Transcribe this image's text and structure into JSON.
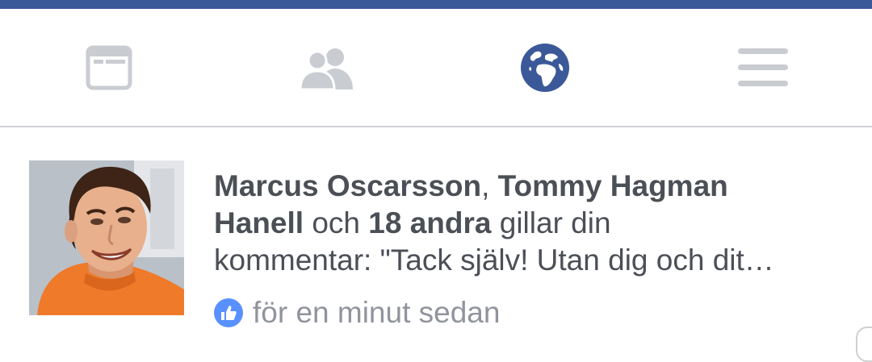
{
  "tabs": [
    {
      "icon": "news-feed-icon",
      "active": false
    },
    {
      "icon": "friends-icon",
      "active": false
    },
    {
      "icon": "globe-notifications-icon",
      "active": true
    },
    {
      "icon": "menu-icon",
      "active": false
    }
  ],
  "colors": {
    "brand": "#3b5998",
    "inactive_icon": "#c9ccd1",
    "text": "#4b4f56",
    "time": "#90949c",
    "like_badge": "#5890ff"
  },
  "notification": {
    "user1": "Marcus Oscarsson",
    "sep1": ", ",
    "user2_part1": "Tommy Hagman",
    "user2_part2": "Hanell",
    "connector": " och ",
    "others": "18 andra",
    "action": " gillar din",
    "comment": "kommentar: \"Tack själv! Utan dig och dit…",
    "time": "för en minut sedan"
  }
}
